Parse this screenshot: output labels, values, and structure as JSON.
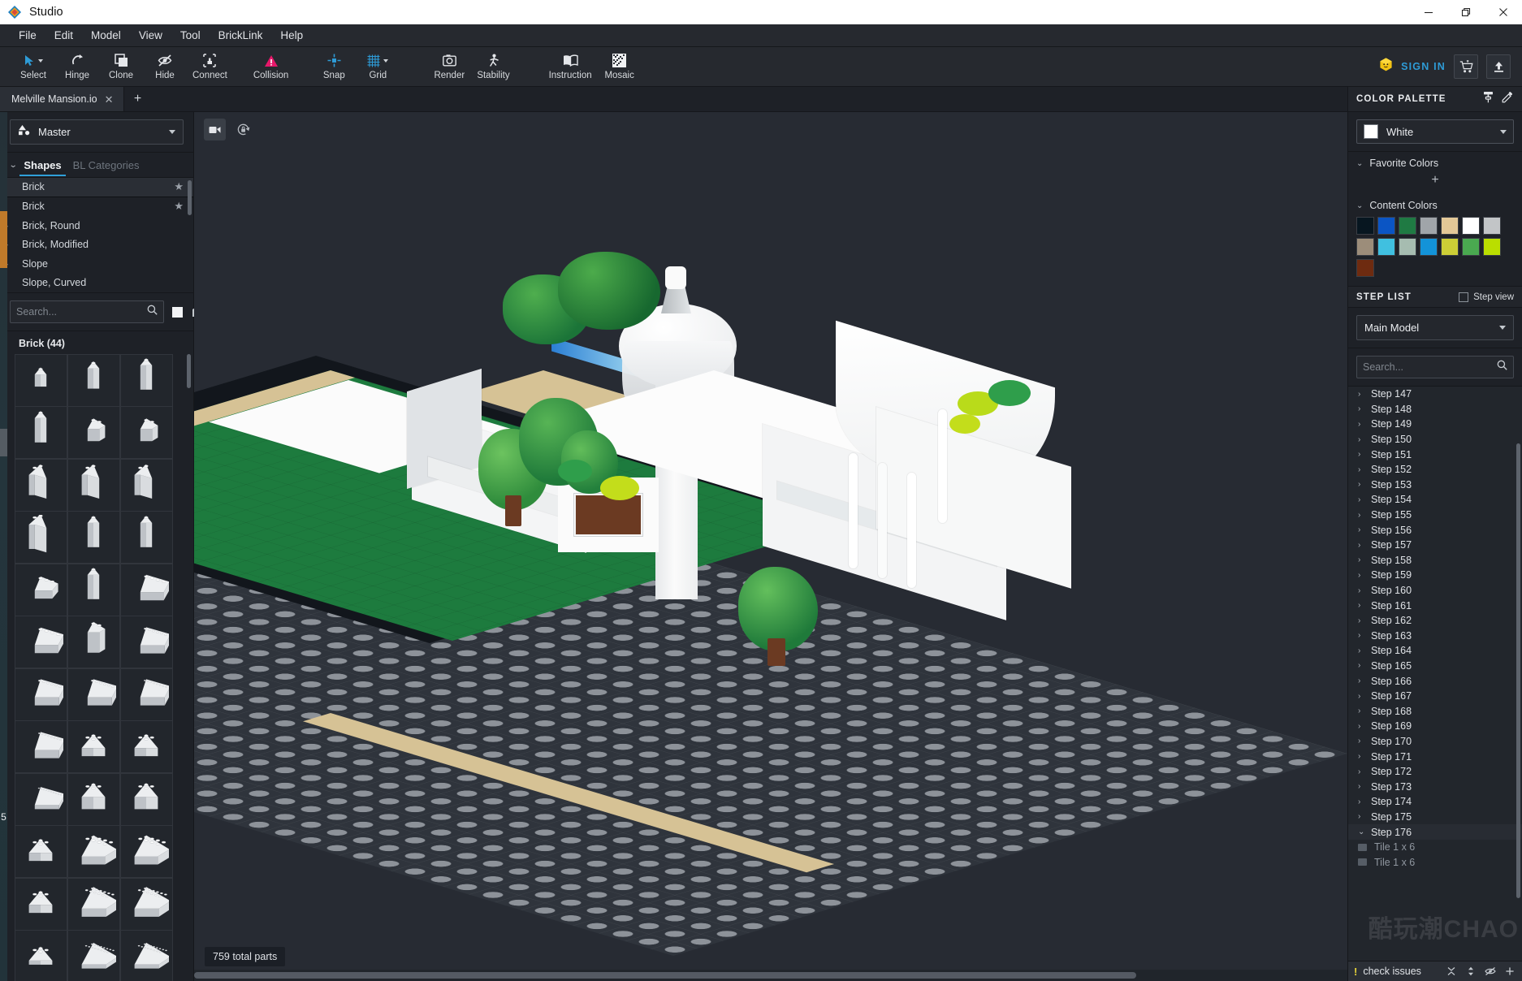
{
  "window": {
    "title": "Studio",
    "controls": {
      "minimize": "—",
      "maximize": "❐",
      "close": "✕"
    }
  },
  "menubar": {
    "items": [
      {
        "label": "File"
      },
      {
        "label": "Edit"
      },
      {
        "label": "Model"
      },
      {
        "label": "View"
      },
      {
        "label": "Tool"
      },
      {
        "label": "BrickLink"
      },
      {
        "label": "Help"
      }
    ]
  },
  "toolbar": {
    "tools": [
      {
        "label": "Select",
        "icon": "cursor-arrow-icon",
        "has_caret": true
      },
      {
        "label": "Hinge",
        "icon": "hinge-icon",
        "has_caret": false
      },
      {
        "label": "Clone",
        "icon": "clone-icon",
        "has_caret": false
      },
      {
        "label": "Hide",
        "icon": "eye-slash-icon",
        "has_caret": false
      },
      {
        "label": "Connect",
        "icon": "connect-icon",
        "has_caret": false
      },
      {
        "label": "Collision",
        "icon": "collision-icon",
        "has_caret": false
      },
      {
        "label": "Snap",
        "icon": "snap-icon",
        "has_caret": false
      },
      {
        "label": "Grid",
        "icon": "grid-icon",
        "has_caret": true
      },
      {
        "label": "Render",
        "icon": "camera-icon",
        "has_caret": false
      },
      {
        "label": "Stability",
        "icon": "stability-icon",
        "has_caret": false
      },
      {
        "label": "Instruction",
        "icon": "book-icon",
        "has_caret": false
      },
      {
        "label": "Mosaic",
        "icon": "mosaic-icon",
        "has_caret": false
      }
    ],
    "sign_in_label": "SIGN IN",
    "cart_icon": "cart-icon",
    "upload_icon": "upload-icon",
    "accent_color": "#2e9bd6",
    "collision_color": "#e6186a"
  },
  "tabbar": {
    "document_tab": "Melville Mansion.io",
    "close_glyph": "✕",
    "add_glyph": "+",
    "nav_prev": "◀",
    "nav_next": "▶"
  },
  "left_panel": {
    "master_dropdown": {
      "label": "Master",
      "icon": "shapes-icon"
    },
    "tabs": [
      {
        "label": "Shapes",
        "active": true
      },
      {
        "label": "BL Categories",
        "active": false
      }
    ],
    "categories": [
      {
        "label": "Brick",
        "expandable": false,
        "starred": true,
        "selected": true
      },
      {
        "label": "Brick",
        "expandable": false,
        "starred": true,
        "selected": false
      },
      {
        "label": "Brick, Round",
        "expandable": true,
        "starred": false,
        "selected": false
      },
      {
        "label": "Brick, Modified",
        "expandable": true,
        "starred": false,
        "selected": false
      },
      {
        "label": "Slope",
        "expandable": true,
        "starred": false,
        "selected": false
      },
      {
        "label": "Slope, Curved",
        "expandable": false,
        "starred": false,
        "selected": false
      }
    ],
    "search": {
      "placeholder": "Search...",
      "value": "",
      "icon": "search-icon"
    },
    "view_toggles": [
      {
        "icon": "view-large-icon"
      },
      {
        "icon": "view-medium-icon"
      },
      {
        "icon": "view-grid-icon"
      }
    ],
    "parts_header": "Brick (44)",
    "parts_count": 36
  },
  "viewport": {
    "camera_icon": "camera-view-icon",
    "lock_icon": "lock-rotate-icon",
    "status_text": "759 total parts"
  },
  "color_palette": {
    "title": "COLOR PALETTE",
    "header_icons": [
      {
        "icon": "paint-roller-icon"
      },
      {
        "icon": "eyedropper-icon"
      }
    ],
    "selected_color": {
      "name": "White",
      "hex": "#ffffff"
    },
    "favorite_colors": {
      "label": "Favorite Colors",
      "add_glyph": "+",
      "colors": []
    },
    "content_colors": {
      "label": "Content Colors",
      "colors": [
        "#071620",
        "#0b55c4",
        "#1f7a43",
        "#a0a5a9",
        "#e3c897",
        "#ffffff",
        "#c2c5c7",
        "#9c8d7a",
        "#40c0e0",
        "#a6bcb0",
        "#1393d8",
        "#ccce36",
        "#4aa950",
        "#bade00",
        "#6e2b10"
      ]
    }
  },
  "step_list": {
    "title": "STEP LIST",
    "step_view_label": "Step view",
    "step_view_checked": false,
    "model_dropdown": "Main Model",
    "search": {
      "placeholder": "Search...",
      "value": "",
      "icon": "search-icon"
    },
    "steps": [
      {
        "label": "Step 147",
        "expanded": false
      },
      {
        "label": "Step 148",
        "expanded": false
      },
      {
        "label": "Step 149",
        "expanded": false
      },
      {
        "label": "Step 150",
        "expanded": false
      },
      {
        "label": "Step 151",
        "expanded": false
      },
      {
        "label": "Step 152",
        "expanded": false
      },
      {
        "label": "Step 153",
        "expanded": false
      },
      {
        "label": "Step 154",
        "expanded": false
      },
      {
        "label": "Step 155",
        "expanded": false
      },
      {
        "label": "Step 156",
        "expanded": false
      },
      {
        "label": "Step 157",
        "expanded": false
      },
      {
        "label": "Step 158",
        "expanded": false
      },
      {
        "label": "Step 159",
        "expanded": false
      },
      {
        "label": "Step 160",
        "expanded": false
      },
      {
        "label": "Step 161",
        "expanded": false
      },
      {
        "label": "Step 162",
        "expanded": false
      },
      {
        "label": "Step 163",
        "expanded": false
      },
      {
        "label": "Step 164",
        "expanded": false
      },
      {
        "label": "Step 165",
        "expanded": false
      },
      {
        "label": "Step 166",
        "expanded": false
      },
      {
        "label": "Step 167",
        "expanded": false
      },
      {
        "label": "Step 168",
        "expanded": false
      },
      {
        "label": "Step 169",
        "expanded": false
      },
      {
        "label": "Step 170",
        "expanded": false
      },
      {
        "label": "Step 171",
        "expanded": false
      },
      {
        "label": "Step 172",
        "expanded": false
      },
      {
        "label": "Step 173",
        "expanded": false
      },
      {
        "label": "Step 174",
        "expanded": false
      },
      {
        "label": "Step 175",
        "expanded": false
      },
      {
        "label": "Step 176",
        "expanded": true
      }
    ],
    "expanded_parts": [
      {
        "label": "Tile 1 x 6"
      },
      {
        "label": "Tile 1 x 6"
      }
    ],
    "watermark": "酷玩潮CHAO"
  },
  "status_bar": {
    "warning_glyph": "!",
    "text": "check issues",
    "icons": [
      {
        "icon": "collapse-icon"
      },
      {
        "icon": "sort-icon"
      },
      {
        "icon": "eye-slash-icon"
      },
      {
        "icon": "plus-icon"
      }
    ]
  }
}
